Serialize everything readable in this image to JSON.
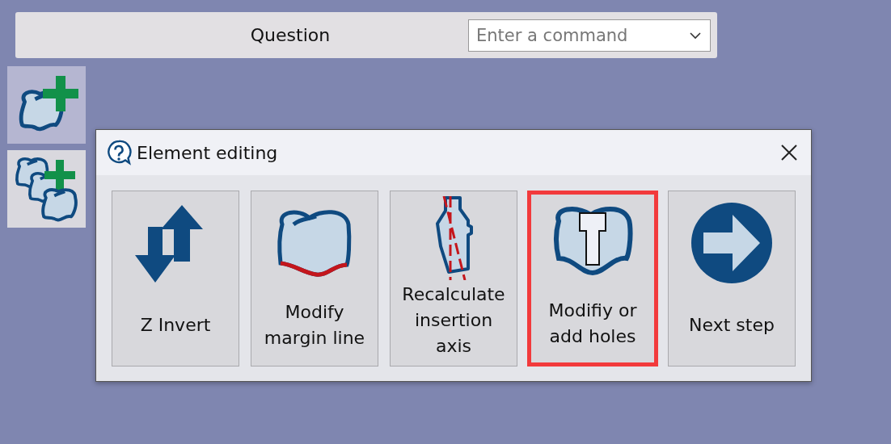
{
  "top_bar": {
    "title": "Question",
    "command": {
      "placeholder": "Enter a command"
    }
  },
  "side_tools": [
    {
      "kind": "add-single",
      "selected": true
    },
    {
      "kind": "add-multiple",
      "selected": false
    }
  ],
  "dialog": {
    "title": "Element editing",
    "actions": [
      {
        "kind": "invert",
        "label": "Z Invert",
        "selected": false
      },
      {
        "kind": "margin",
        "label": "Modify margin line",
        "selected": false
      },
      {
        "kind": "axis",
        "label": "Recalculate insertion axis",
        "selected": false
      },
      {
        "kind": "holes",
        "label": "Modifiy or add holes",
        "selected": true
      },
      {
        "kind": "next",
        "label": "Next step",
        "selected": false
      }
    ]
  }
}
